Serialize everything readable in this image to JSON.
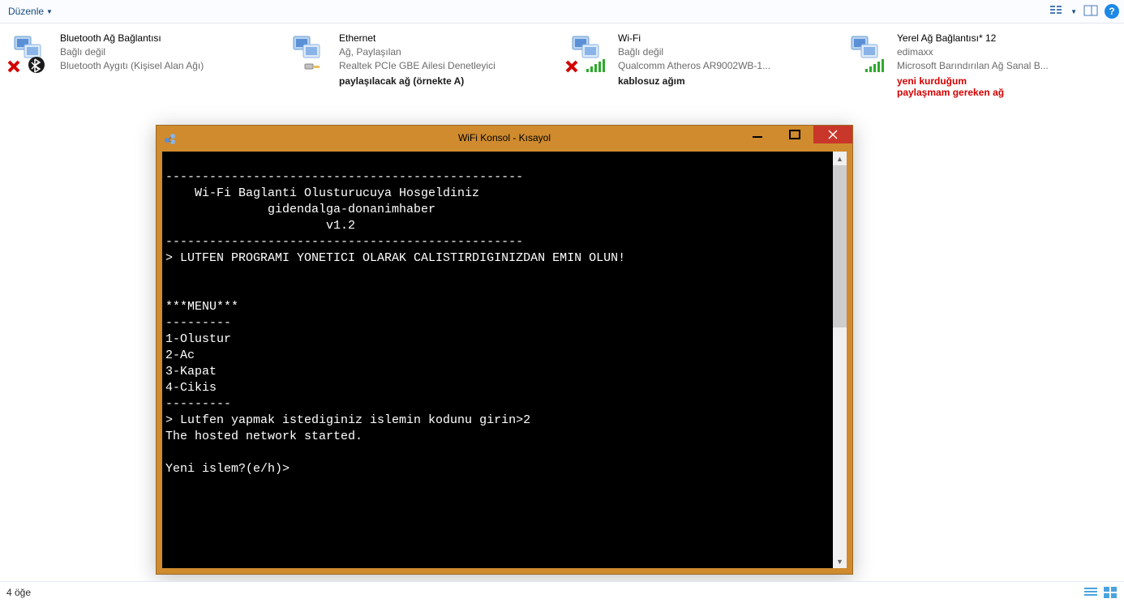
{
  "toolbar": {
    "organize": "Düzenle",
    "help_tooltip": "?"
  },
  "adapters": [
    {
      "title": "Bluetooth Ağ Bağlantısı",
      "status": "Bağlı değil",
      "device": "Bluetooth Aygıtı (Kişisel Alan Ağı)",
      "overlay": "red-x",
      "overlay2": "bluetooth",
      "annotation": "",
      "annotation_color": ""
    },
    {
      "title": "Ethernet",
      "status": "Ağ, Paylaşılan",
      "device": "Realtek PCIe GBE Ailesi Denetleyici",
      "overlay": "cable",
      "overlay2": "",
      "annotation": "paylaşılacak ağ (örnekte A)",
      "annotation_color": "black"
    },
    {
      "title": "Wi-Fi",
      "status": "Bağlı değil",
      "device": "Qualcomm Atheros AR9002WB-1...",
      "overlay": "red-x",
      "overlay2": "signal",
      "annotation": "kablosuz ağım",
      "annotation_color": "black"
    },
    {
      "title": "Yerel Ağ Bağlantısı* 12",
      "status": "edimaxx",
      "device": "Microsoft Barındırılan Ağ Sanal B...",
      "overlay": "",
      "overlay2": "signal",
      "annotation": "yeni kurduğum\npaylaşmam gereken ağ",
      "annotation_color": "red"
    }
  ],
  "console": {
    "title": "WiFi Konsol - Kısayol",
    "lines": [
      "",
      "-------------------------------------------------",
      "    Wi-Fi Baglanti Olusturucuya Hosgeldiniz",
      "              gidendalga-donanimhaber",
      "                      v1.2",
      "-------------------------------------------------",
      "> LUTFEN PROGRAMI YONETICI OLARAK CALISTIRDIGINIZDAN EMIN OLUN!",
      "",
      "",
      "***MENU***",
      "---------",
      "1-Olustur",
      "2-Ac",
      "3-Kapat",
      "4-Cikis",
      "---------",
      "> Lutfen yapmak istediginiz islemin kodunu girin>2",
      "The hosted network started.",
      "",
      "Yeni islem?(e/h)>"
    ]
  },
  "statusbar": {
    "text": "4 öğe"
  }
}
